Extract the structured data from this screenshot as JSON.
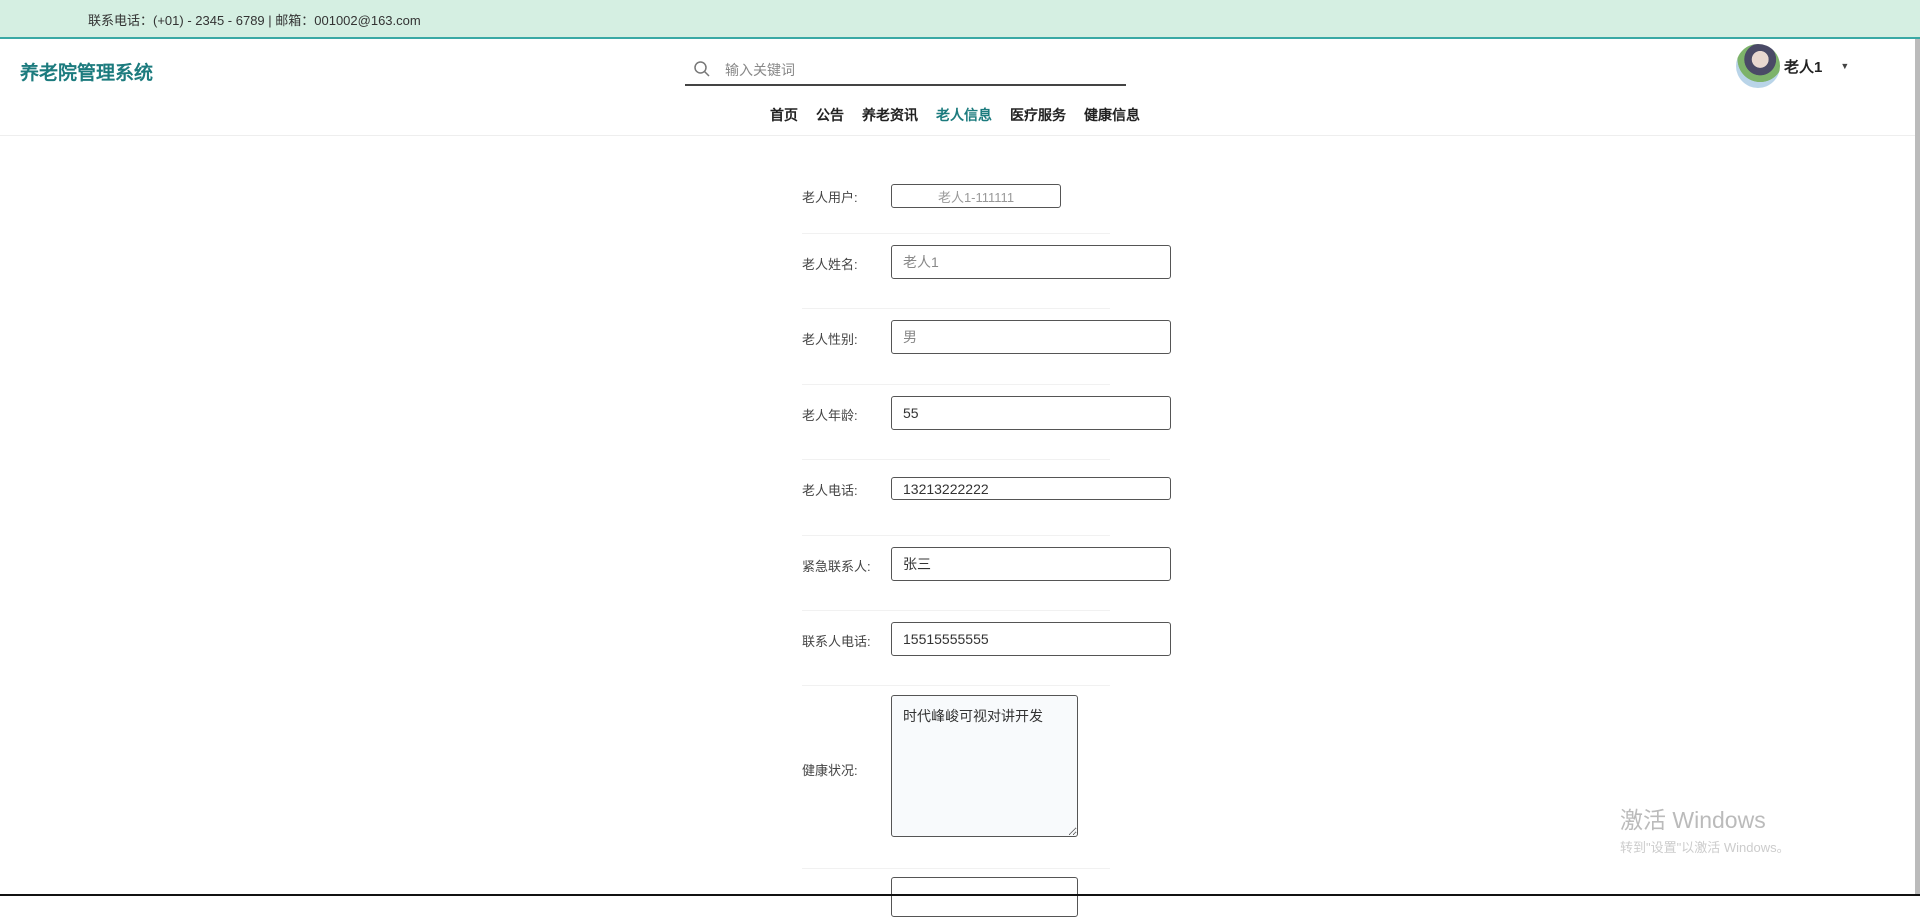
{
  "topbar": {
    "contact": "联系电话：(+01) - 2345 - 6789 | 邮箱：001002@163.com"
  },
  "header": {
    "logo": "养老院管理系统",
    "search_placeholder": "输入关键词",
    "user_name": "老人1"
  },
  "nav": [
    {
      "label": "首页"
    },
    {
      "label": "公告"
    },
    {
      "label": "养老资讯"
    },
    {
      "label": "老人信息",
      "active": true
    },
    {
      "label": "医疗服务"
    },
    {
      "label": "健康信息"
    }
  ],
  "form": {
    "user": {
      "label": "老人用户:",
      "value": "老人1-111111"
    },
    "name": {
      "label": "老人姓名:",
      "value": "老人1"
    },
    "gender": {
      "label": "老人性别:",
      "value": "男"
    },
    "age": {
      "label": "老人年龄:",
      "value": "55"
    },
    "phone": {
      "label": "老人电话:",
      "value": "13213222222"
    },
    "contact": {
      "label": "紧急联系人:",
      "value": "张三"
    },
    "contact_phone": {
      "label": "联系人电话:",
      "value": "15515555555"
    },
    "health": {
      "label": "健康状况:",
      "value": "时代峰峻可视对讲开发\n"
    }
  },
  "watermark": {
    "title": "激活 Windows",
    "subtitle": "转到\"设置\"以激活 Windows。"
  },
  "colors": {
    "accent": "#1c7b7e",
    "topbar_bg": "#d5efe2",
    "topbar_border": "#3aa9a5"
  }
}
